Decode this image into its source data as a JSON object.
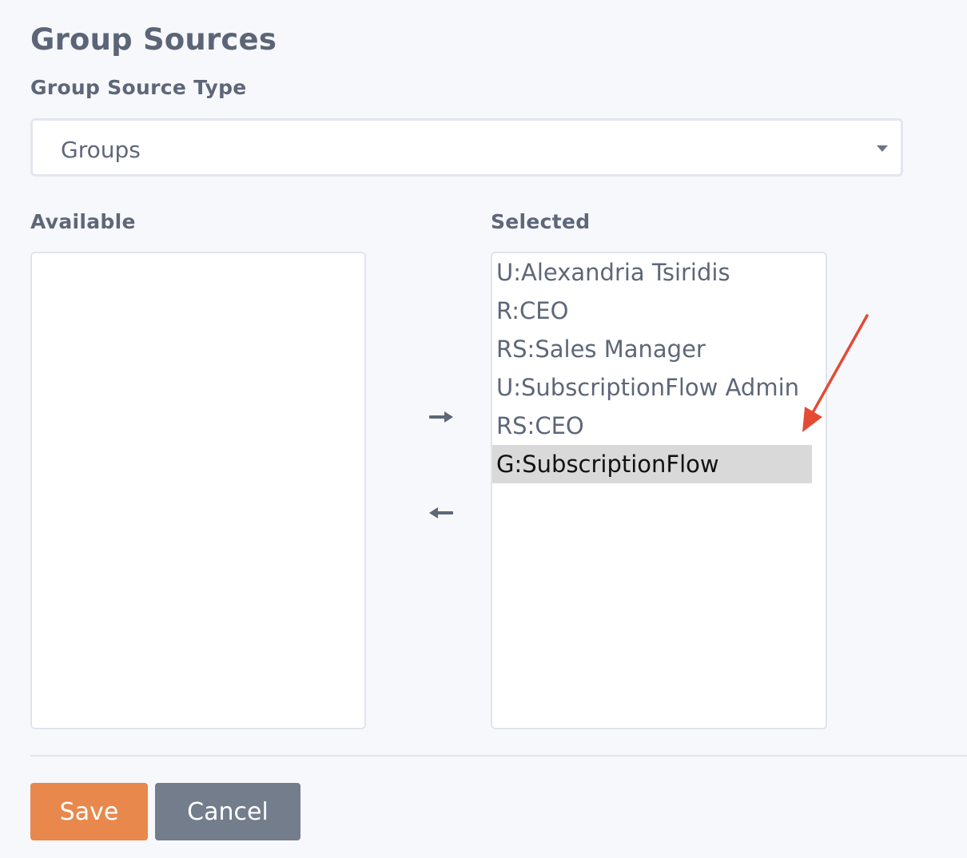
{
  "form": {
    "title": "Group Sources",
    "type_label": "Group Source Type",
    "type_value": "Groups"
  },
  "dual_list": {
    "available_label": "Available",
    "selected_label": "Selected",
    "available_items": [],
    "selected_items": [
      {
        "label": "U:Alexandria Tsiridis",
        "highlighted": false
      },
      {
        "label": "R:CEO",
        "highlighted": false
      },
      {
        "label": "RS:Sales Manager",
        "highlighted": false
      },
      {
        "label": "U:SubscriptionFlow Admin",
        "highlighted": false
      },
      {
        "label": "RS:CEO",
        "highlighted": false
      },
      {
        "label": "G:SubscriptionFlow",
        "highlighted": true
      }
    ],
    "move_right_icon": "arrow-right-icon",
    "move_left_icon": "arrow-left-icon"
  },
  "actions": {
    "save_label": "Save",
    "cancel_label": "Cancel"
  },
  "colors": {
    "save": "#e8884c",
    "cancel": "#737d8c",
    "highlight_row": "#d9d9d9",
    "annotation_arrow": "#e34b35"
  }
}
